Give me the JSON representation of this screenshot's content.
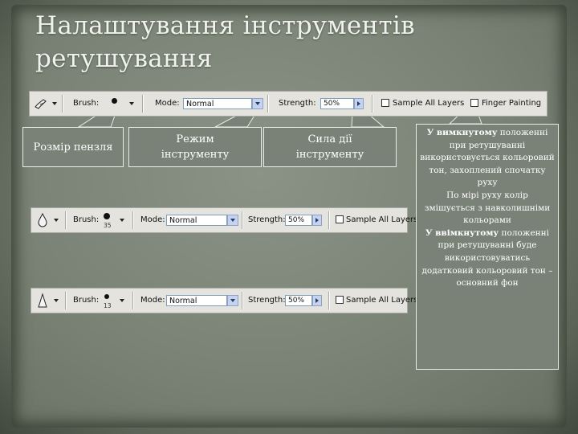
{
  "title": {
    "line1": "Налаштування інструментів",
    "line2": "ретушування"
  },
  "toolbar_top": {
    "brush_label": "Brush:",
    "mode_label": "Mode:",
    "mode_value": "Normal",
    "strength_label": "Strength:",
    "strength_value": "50%",
    "sample_all_layers": "Sample All Layers",
    "finger_painting": "Finger Painting",
    "tool_icon": "smudge-finger-icon"
  },
  "toolbar_blur": {
    "brush_label": "Brush:",
    "brush_size": "35",
    "mode_label": "Mode:",
    "mode_value": "Normal",
    "strength_label": "Strength:",
    "strength_value": "50%",
    "sample_all_layers": "Sample All Layers",
    "tool_icon": "blur-drop-icon"
  },
  "toolbar_sharpen": {
    "brush_label": "Brush:",
    "brush_size": "13",
    "mode_label": "Mode:",
    "mode_value": "Normal",
    "strength_label": "Strength:",
    "strength_value": "50%",
    "sample_all_layers": "Sample All Layers",
    "tool_icon": "sharpen-triangle-icon"
  },
  "callouts": {
    "brush_size": "Розмір пензля",
    "mode_line1": "Режим",
    "mode_line2": "інструменту",
    "strength_line1": "Сила дії",
    "strength_line2": "інструменту"
  },
  "note": {
    "p1_bold": "У вимкнутому",
    "p1_rest": "положенні при ретушуванні використовується кольоровий тон, захоплений спочатку руху",
    "p2": "По мірі руху колір змішується з навколишніми кольорами",
    "p3_bold": "У ввімкнутому",
    "p3_rest": "положенні при ретушуванні буде використовуватись додатковий кольоровий тон – основний фон"
  },
  "colors": {
    "background": "#7a8376",
    "callout_fill": "#7a8277",
    "callout_border": "#e9ebe6",
    "toolbar": "#e4e3de"
  }
}
